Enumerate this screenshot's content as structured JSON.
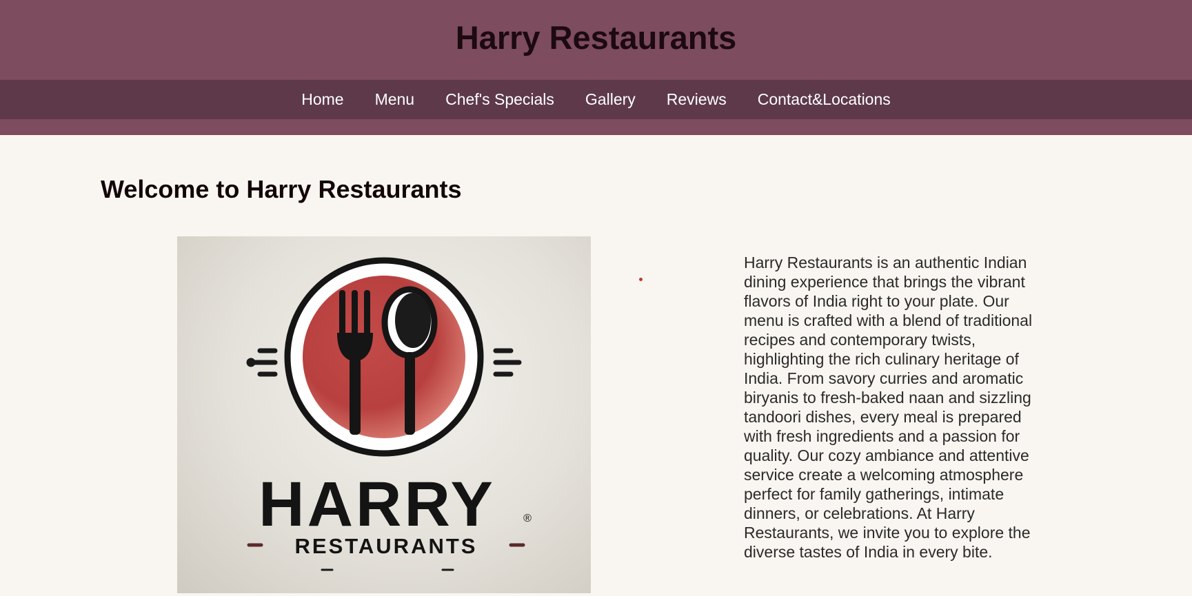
{
  "header": {
    "title": "Harry Restaurants"
  },
  "nav": {
    "items": [
      {
        "label": "Home"
      },
      {
        "label": "Menu"
      },
      {
        "label": "Chef's Specials"
      },
      {
        "label": "Gallery"
      },
      {
        "label": "Reviews"
      },
      {
        "label": "Contact&Locations"
      }
    ]
  },
  "main": {
    "heading": "Welcome to Harry Restaurants",
    "logo": {
      "brand": "HARRY",
      "sub": "RESTAURANTS",
      "mark": "®",
      "icon": "fork-and-spoon-plate-icon"
    },
    "about": "Harry Restaurants is an authentic Indian dining experience that brings the vibrant flavors of India right to your plate. Our menu is crafted with a blend of traditional recipes and contemporary twists, highlighting the rich culinary heritage of India. From savory curries and aromatic biryanis to fresh-baked naan and sizzling tandoori dishes, every meal is prepared with fresh ingredients and a passion for quality. Our cozy ambiance and attentive service create a welcoming atmosphere perfect for family gatherings, intimate dinners, or celebrations. At Harry Restaurants, we invite you to explore the diverse tastes of India in every bite."
  },
  "colors": {
    "header_bg": "#7d4c5e",
    "nav_bg": "#5d394a",
    "page_bg": "#f9f6f1",
    "logo_accent": "#c0504a"
  }
}
